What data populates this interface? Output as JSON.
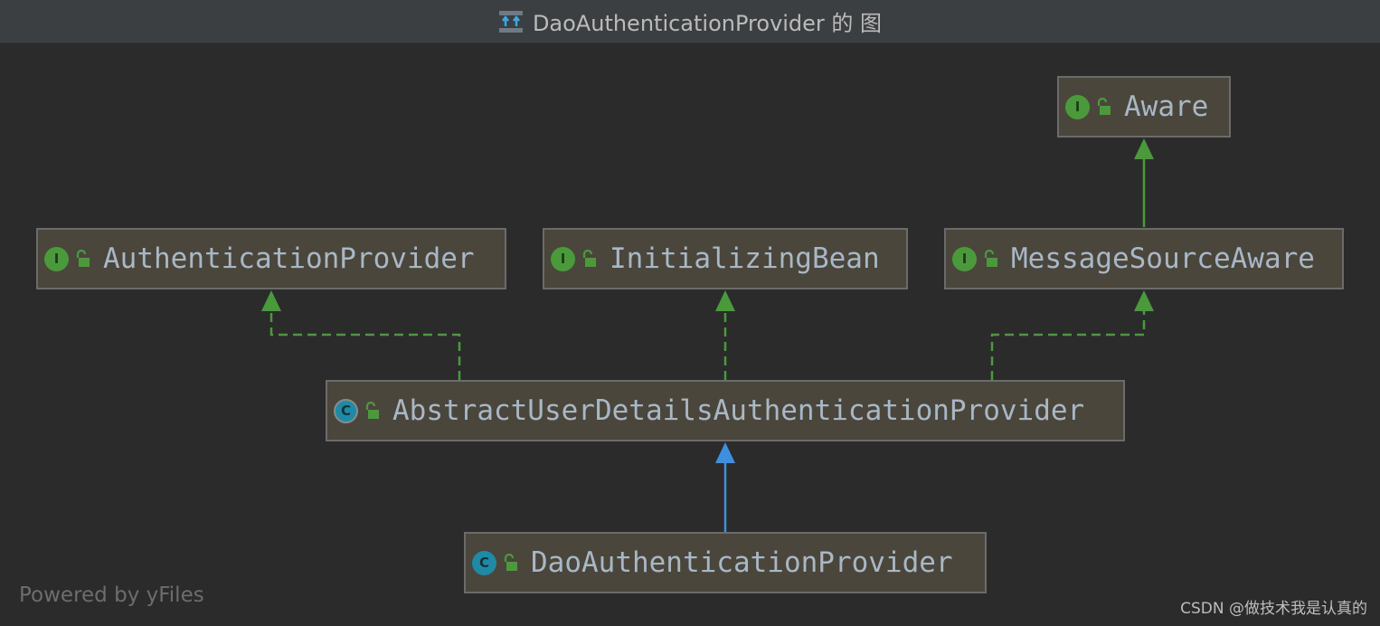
{
  "window": {
    "title": "DaoAuthenticationProvider 的 图"
  },
  "nodes": {
    "aware": {
      "label": "Aware",
      "kind": "interface",
      "badge": "I"
    },
    "authentication_provider": {
      "label": "AuthenticationProvider",
      "kind": "interface",
      "badge": "I"
    },
    "initializing_bean": {
      "label": "InitializingBean",
      "kind": "interface",
      "badge": "I"
    },
    "message_source_aware": {
      "label": "MessageSourceAware",
      "kind": "interface",
      "badge": "I"
    },
    "abstract_user_details": {
      "label": "AbstractUserDetailsAuthenticationProvider",
      "kind": "abstract-class",
      "badge": "C"
    },
    "dao_authentication_provider": {
      "label": "DaoAuthenticationProvider",
      "kind": "class",
      "badge": "C"
    }
  },
  "edges": [
    {
      "from": "MessageSourceAware",
      "to": "Aware",
      "type": "extends",
      "style": "solid",
      "color": "#4a9a3c"
    },
    {
      "from": "AbstractUserDetailsAuthenticationProvider",
      "to": "AuthenticationProvider",
      "type": "implements",
      "style": "dashed",
      "color": "#4a9a3c"
    },
    {
      "from": "AbstractUserDetailsAuthenticationProvider",
      "to": "InitializingBean",
      "type": "implements",
      "style": "dashed",
      "color": "#4a9a3c"
    },
    {
      "from": "AbstractUserDetailsAuthenticationProvider",
      "to": "MessageSourceAware",
      "type": "implements",
      "style": "dashed",
      "color": "#4a9a3c"
    },
    {
      "from": "DaoAuthenticationProvider",
      "to": "AbstractUserDetailsAuthenticationProvider",
      "type": "extends",
      "style": "solid",
      "color": "#3f8fe0"
    }
  ],
  "colors": {
    "background": "#2b2b2b",
    "node_fill": "#4a463b",
    "node_border": "#6b6b6b",
    "interface_badge": "#4a9a3c",
    "class_badge": "#1f8aa6",
    "implements_edge": "#4a9a3c",
    "extends_class_edge": "#3f8fe0"
  },
  "footer": {
    "powered_by": "Powered by yFiles",
    "watermark": "CSDN @做技术我是认真的"
  }
}
